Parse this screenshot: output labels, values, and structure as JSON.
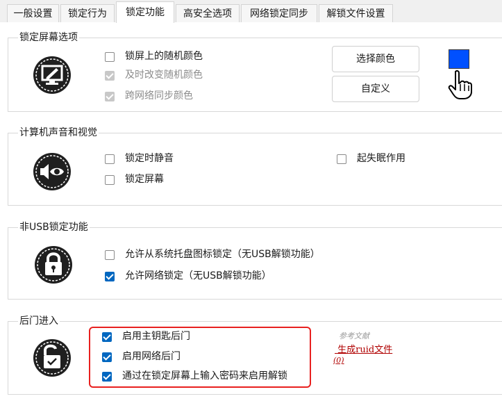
{
  "tabs": [
    {
      "label": "一般设置",
      "active": false
    },
    {
      "label": "锁定行为",
      "active": false
    },
    {
      "label": "锁定功能",
      "active": true
    },
    {
      "label": "高安全选项",
      "active": false
    },
    {
      "label": "网络锁定同步",
      "active": false
    },
    {
      "label": "解锁文件设置",
      "active": false
    }
  ],
  "lock_screen": {
    "title": "锁定屏幕选项",
    "options": [
      {
        "label": "锁屏上的随机颜色",
        "checked": false,
        "enabled": true
      },
      {
        "label": "及时改变随机颜色",
        "checked": true,
        "enabled": false
      },
      {
        "label": "跨网络同步颜色",
        "checked": true,
        "enabled": false
      }
    ],
    "choose_color_label": "选择颜色",
    "custom_label": "自定义",
    "swatch_color": "#0050ff"
  },
  "sound_visual": {
    "title": "计算机声音和视觉",
    "options": [
      {
        "label": "锁定时静音",
        "checked": false
      },
      {
        "label": "锁定屏幕",
        "checked": false
      },
      {
        "label": "起失眠作用",
        "checked": false
      }
    ]
  },
  "non_usb": {
    "title": "非USB锁定功能",
    "options": [
      {
        "label": "允许从系统托盘图标锁定（无USB解锁功能）",
        "checked": false
      },
      {
        "label": "允许网络锁定（无USB解锁功能）",
        "checked": true
      }
    ]
  },
  "backdoor": {
    "title": "后门进入",
    "options": [
      {
        "label": "启用主钥匙后门",
        "checked": true
      },
      {
        "label": "启用网络后门",
        "checked": true
      },
      {
        "label": "通过在锁定屏幕上输入密码来启用解锁",
        "checked": true
      }
    ],
    "reference_note": "参考文献",
    "generate_link": " 生成ruid文件",
    "index_note": "(0)",
    "highlight_color": "#e8201f"
  }
}
